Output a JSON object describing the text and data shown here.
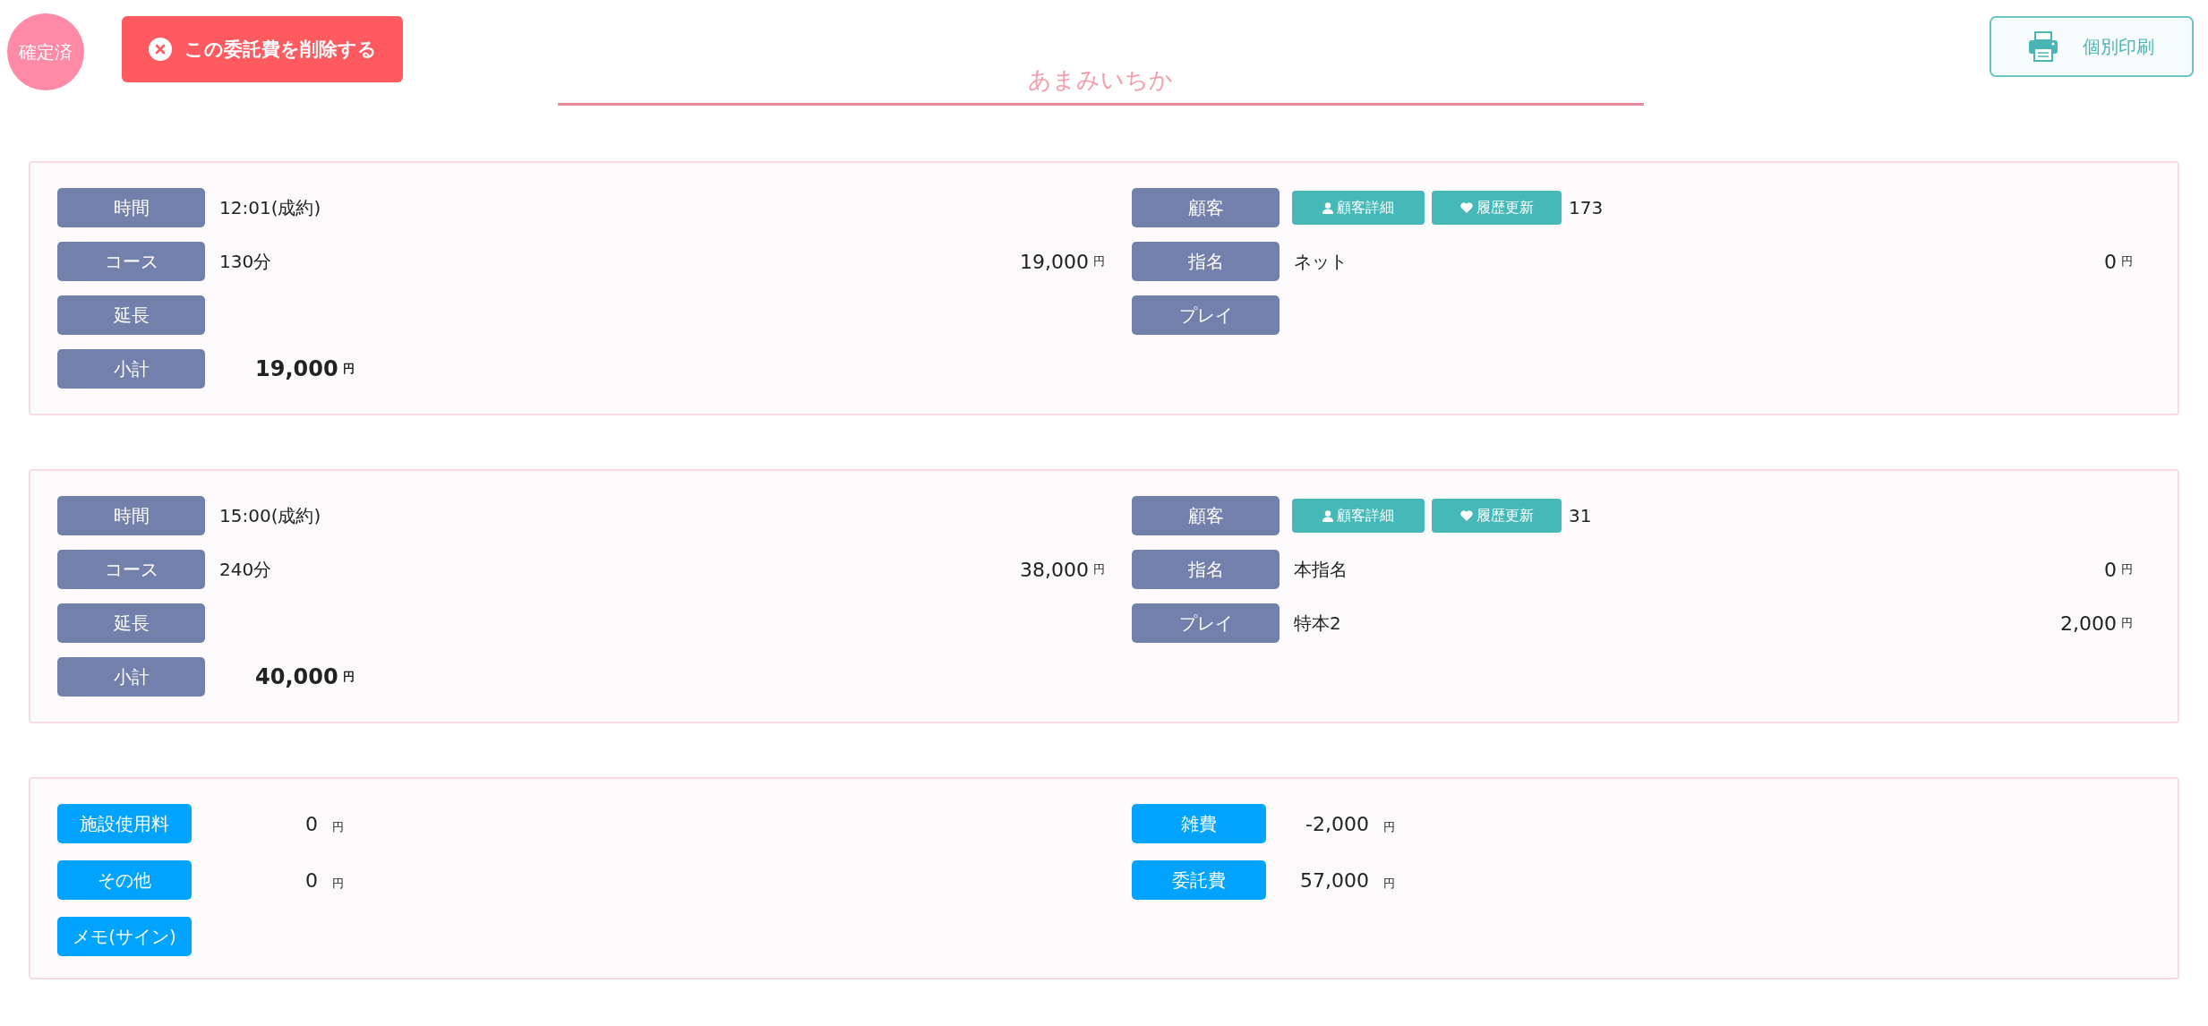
{
  "status_badge": "確定済",
  "delete_button": {
    "label": "この委託費を削除する"
  },
  "title": "あまみいちか",
  "print_button": {
    "label": "個別印刷"
  },
  "reservations": [
    {
      "left_rows": [
        {
          "kind": "text",
          "label": "時間",
          "value": "12:01(成約)"
        },
        {
          "kind": "text",
          "label": "コース",
          "value": "130分",
          "amount": "19,000",
          "unit": "円"
        },
        {
          "kind": "text",
          "label": "延長"
        },
        {
          "kind": "total",
          "label": "小計",
          "amount": "19,000",
          "unit": "円"
        }
      ],
      "right_rows": [
        {
          "kind": "text",
          "label": "顧客",
          "buttons": [
            {
              "kind": "person",
              "label": "顧客詳細"
            },
            {
              "kind": "heart",
              "label": "履歴更新"
            }
          ],
          "value": "173"
        },
        {
          "kind": "text",
          "label": "指名",
          "value": "ネット",
          "amount": "0",
          "unit": "円"
        },
        {
          "kind": "text",
          "label": "プレイ"
        }
      ]
    },
    {
      "left_rows": [
        {
          "kind": "text",
          "label": "時間",
          "value": "15:00(成約)"
        },
        {
          "kind": "text",
          "label": "コース",
          "value": "240分",
          "amount": "38,000",
          "unit": "円"
        },
        {
          "kind": "text",
          "label": "延長"
        },
        {
          "kind": "total",
          "label": "小計",
          "amount": "40,000",
          "unit": "円"
        }
      ],
      "right_rows": [
        {
          "kind": "text",
          "label": "顧客",
          "buttons": [
            {
              "kind": "person",
              "label": "顧客詳細"
            },
            {
              "kind": "heart",
              "label": "履歴更新"
            }
          ],
          "value": "31"
        },
        {
          "kind": "text",
          "label": "指名",
          "value": "本指名",
          "amount": "0",
          "unit": "円"
        },
        {
          "kind": "text",
          "label": "プレイ",
          "value": "特本2",
          "amount": "2,000",
          "unit": "円"
        }
      ]
    }
  ],
  "summary": {
    "left_rows": [
      {
        "label": "施設使用料",
        "amount": "0",
        "unit": "円"
      },
      {
        "label": "その他",
        "amount": "0",
        "unit": "円"
      },
      {
        "label": "メモ(サイン)"
      }
    ],
    "right_rows": [
      {
        "label": "雑費",
        "amount": "-2,000",
        "unit": "円"
      },
      {
        "label": "委託費",
        "amount": "57,000",
        "unit": "円"
      }
    ]
  }
}
